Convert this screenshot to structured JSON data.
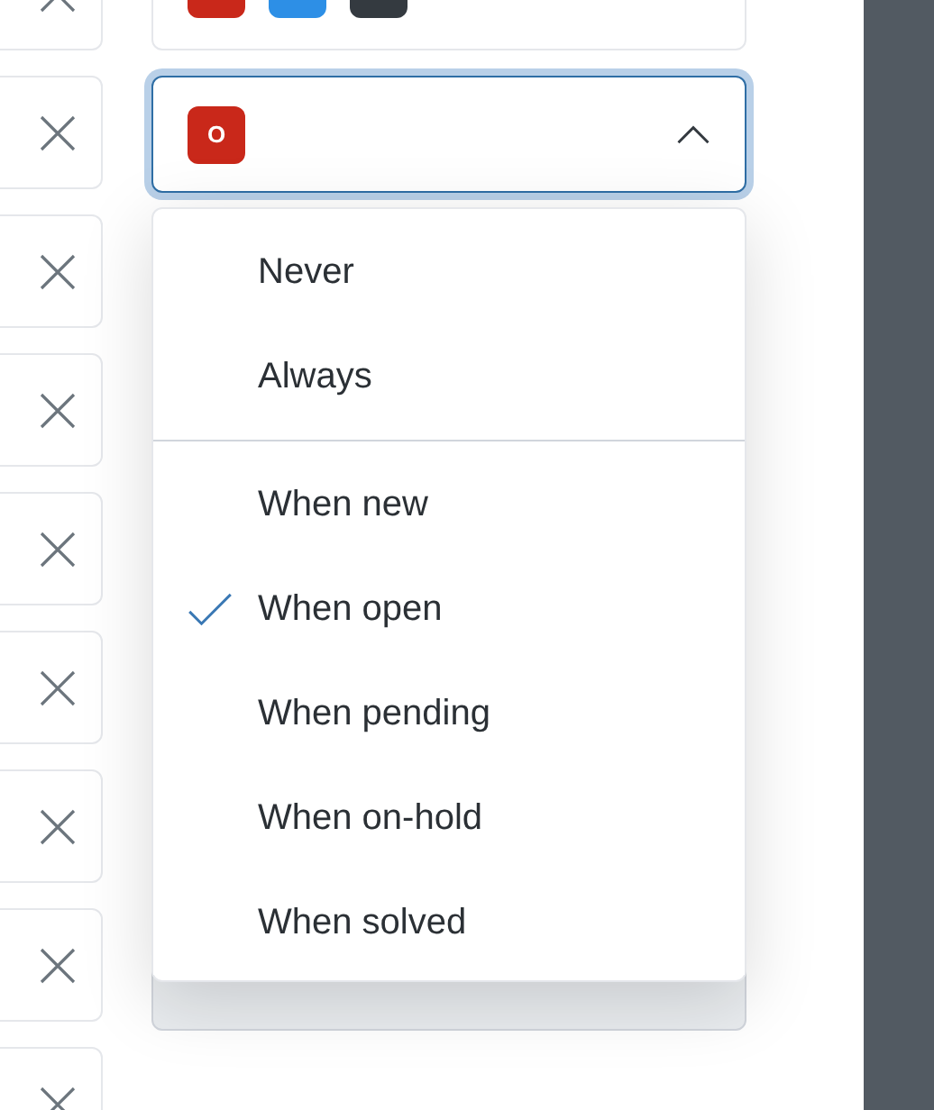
{
  "top_field": {
    "badges": [
      {
        "color": "#c9281a"
      },
      {
        "color": "#2d8fe6"
      },
      {
        "color": "#343a40"
      }
    ]
  },
  "select": {
    "expanded": true,
    "value_badge": {
      "label": "O",
      "color": "#c9281a"
    },
    "option_groups": [
      [
        {
          "label": "Never",
          "selected": false
        },
        {
          "label": "Always",
          "selected": false
        }
      ],
      [
        {
          "label": "When new",
          "selected": false
        },
        {
          "label": "When open",
          "selected": true
        },
        {
          "label": "When pending",
          "selected": false
        },
        {
          "label": "When on-hold",
          "selected": false
        },
        {
          "label": "When solved",
          "selected": false
        }
      ]
    ]
  }
}
